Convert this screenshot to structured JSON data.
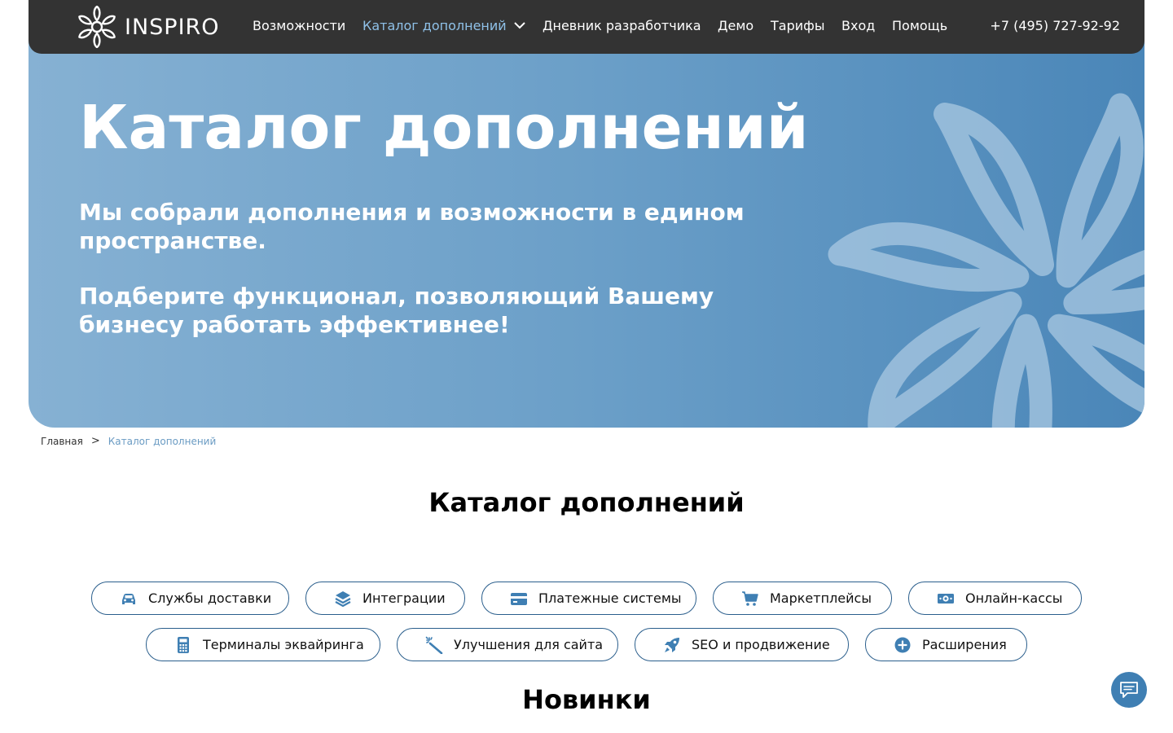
{
  "header": {
    "logo_text": "INSPIRO",
    "nav": [
      {
        "label": "Возможности"
      },
      {
        "label": "Каталог дополнений"
      },
      {
        "label": "Дневник разработчика"
      },
      {
        "label": "Демо"
      },
      {
        "label": "Тарифы"
      },
      {
        "label": "Вход"
      },
      {
        "label": "Помощь"
      }
    ],
    "phone": "+7 (495) 727-92-92"
  },
  "hero": {
    "title": "Каталог дополнений",
    "paragraph1": "Мы собрали дополнения и возможности в едином пространстве.",
    "paragraph2": "Подберите функционал, позволяющий Вашему бизнесу работать эффективнее!"
  },
  "breadcrumb": {
    "home": "Главная",
    "separator": ">",
    "current": "Каталог дополнений"
  },
  "catalog": {
    "title": "Каталог дополнений",
    "categories": [
      {
        "label": "Службы доставки",
        "icon": "car-icon"
      },
      {
        "label": "Интеграции",
        "icon": "layers-icon"
      },
      {
        "label": "Платежные системы",
        "icon": "credit-card-icon"
      },
      {
        "label": "Маркетплейсы",
        "icon": "shopping-cart-icon"
      },
      {
        "label": "Онлайн-кассы",
        "icon": "money-icon"
      },
      {
        "label": "Терминалы эквайринга",
        "icon": "calculator-icon"
      },
      {
        "label": "Улучшения для сайта",
        "icon": "magic-wand-icon"
      },
      {
        "label": "SEO и продвижение",
        "icon": "rocket-icon"
      },
      {
        "label": "Расширения",
        "icon": "plus-circle-icon"
      }
    ]
  },
  "new_section": {
    "title": "Новинки"
  },
  "colors": {
    "header_bg": "#333333",
    "accent": "#8fc1e8",
    "chip_border": "#2a5e8c",
    "icon_color": "#3f7fb3",
    "hero_gradient_start": "#86b1d3",
    "hero_gradient_end": "#4a86b8"
  },
  "chat": {
    "icon": "chat-icon"
  }
}
